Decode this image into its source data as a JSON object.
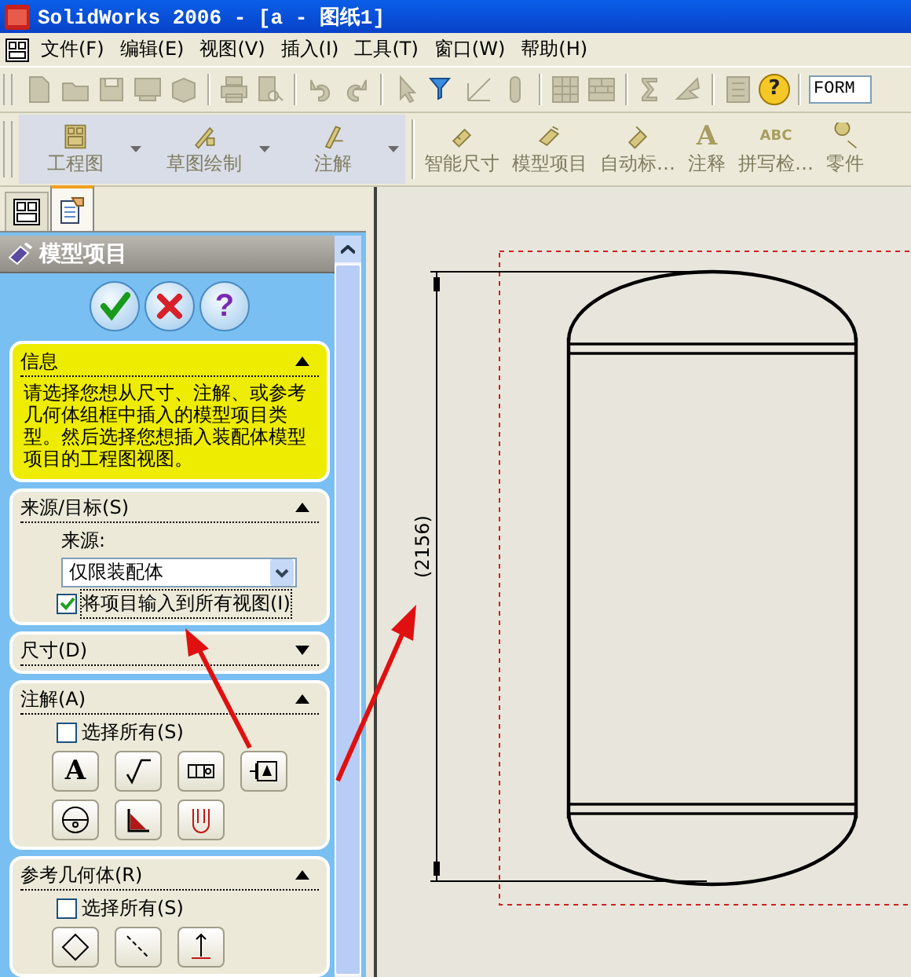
{
  "window": {
    "title": "SolidWorks 2006 - [a - 图纸1]"
  },
  "menu": [
    "文件(F)",
    "编辑(E)",
    "视图(V)",
    "插入(I)",
    "工具(T)",
    "窗口(W)",
    "帮助(H)"
  ],
  "toolbar": {
    "help_glyph": "?",
    "field_value": "FORM"
  },
  "command_manager": [
    {
      "kind": "tab",
      "label": "工程图"
    },
    {
      "kind": "tab",
      "label": "草图绘制"
    },
    {
      "kind": "tab",
      "label": "注解"
    },
    {
      "kind": "tool",
      "label": "智能尺寸"
    },
    {
      "kind": "tool",
      "label": "模型项目"
    },
    {
      "kind": "tool",
      "label": "自动标…"
    },
    {
      "kind": "tool",
      "glyph": "A",
      "label": "注释"
    },
    {
      "kind": "tool",
      "glyph": "ABC",
      "label": "拼写检…"
    },
    {
      "kind": "tool",
      "label": "零件"
    }
  ],
  "panel_tabs": [
    {
      "kind": "feature-tree",
      "selected": false
    },
    {
      "kind": "property",
      "selected": true
    }
  ],
  "property_manager": {
    "title": "模型项目",
    "buttons": [
      {
        "kind": "ok"
      },
      {
        "kind": "cancel"
      },
      {
        "kind": "help",
        "glyph": "?"
      }
    ],
    "info": {
      "title": "信息",
      "expanded": true,
      "text": "请选择您想从尺寸、注解、或参考几何体组框中插入的模型项目类型。然后选择您想插入装配体模型项目的工程图视图。"
    },
    "sections": [
      {
        "kind": "source",
        "title": "来源/目标(S)",
        "expanded": true,
        "source_label": "来源:",
        "source_value": "仅限装配体",
        "import_label": "将项目输入到所有视图(I)",
        "import_checked": true
      },
      {
        "title": "尺寸(D)",
        "expanded": false
      },
      {
        "kind": "annotations",
        "title": "注解(A)",
        "expanded": true,
        "select_all_label": "选择所有(S)",
        "select_all_checked": false,
        "note_glyph": "A"
      },
      {
        "kind": "reference",
        "title": "参考几何体(R)",
        "expanded": true,
        "select_all_label": "选择所有(S)",
        "select_all_checked": false
      }
    ]
  },
  "drawing": {
    "dimension": "(2156)"
  }
}
